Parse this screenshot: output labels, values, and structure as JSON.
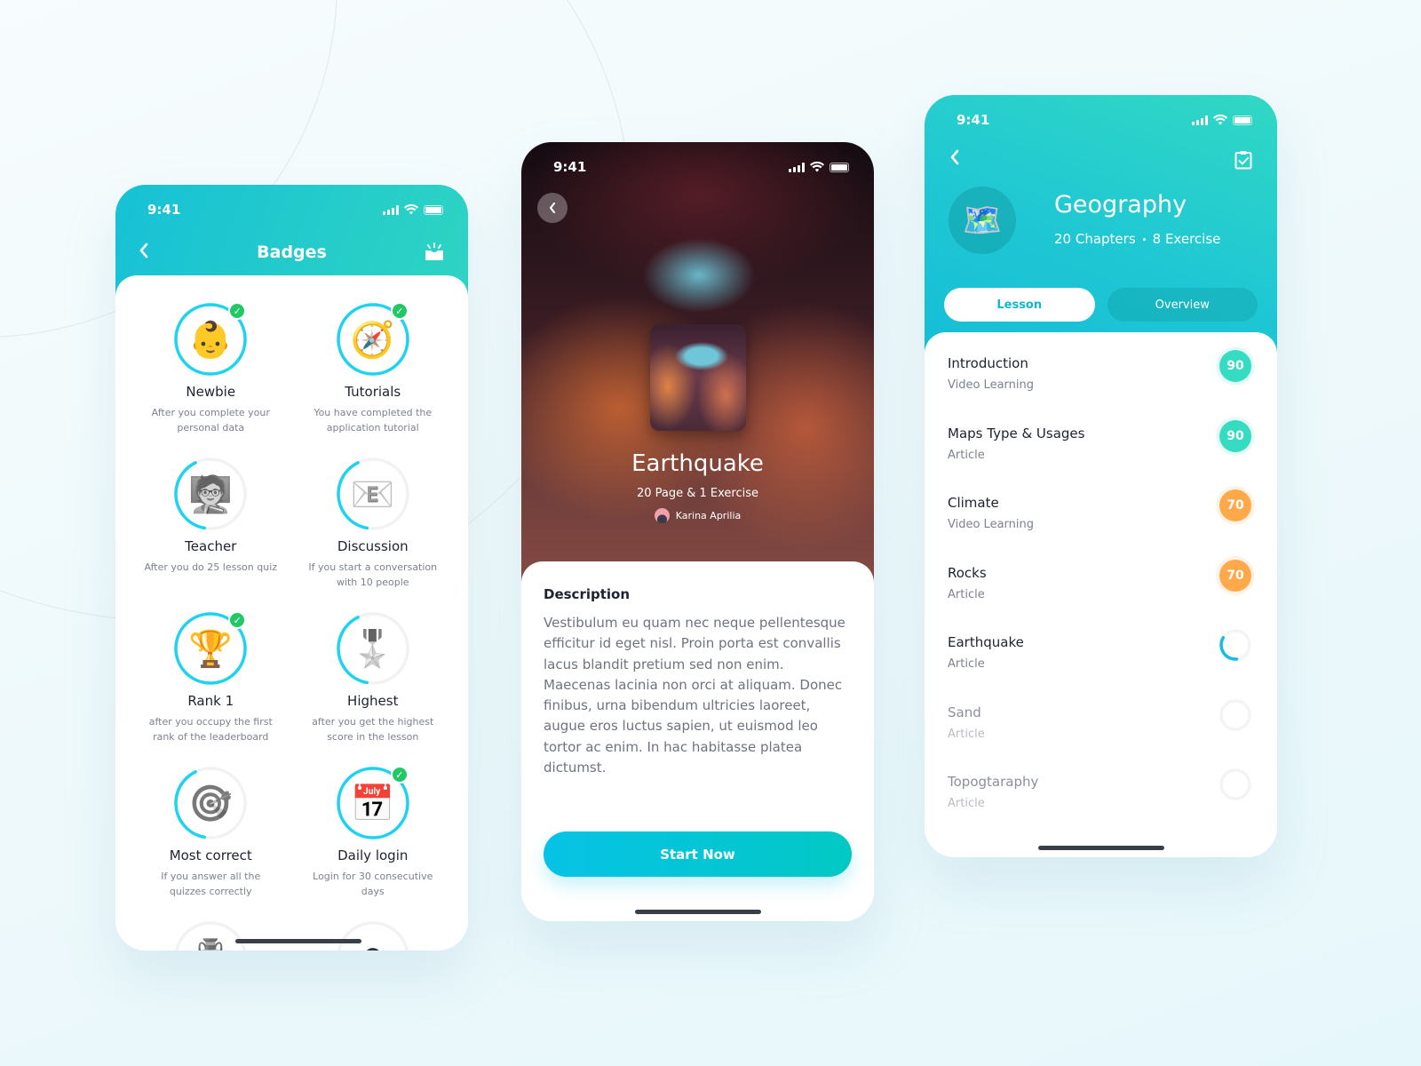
{
  "colors": {
    "accent": "#17c1d6",
    "accent_2": "#2ed4c2",
    "ring": "#1ed3ef",
    "ring_track": "#f1f2f4",
    "check_green": "#22c866",
    "score_high": "#35dcc2",
    "score_mid": "#ffa94a"
  },
  "status_bar": {
    "time": "9:41"
  },
  "badges_screen": {
    "title": "Badges",
    "back_icon": "chevron-left-icon",
    "action_icon": "share-rays-icon",
    "badges": [
      {
        "name": "Newbie",
        "desc": "After you complete your personal data",
        "icon": "baby-face-icon",
        "emoji": "👶",
        "earned": true,
        "progress": 1.0
      },
      {
        "name": "Tutorials",
        "desc": "You have completed the application tutorial",
        "icon": "compass-icon",
        "emoji": "🧭",
        "earned": true,
        "progress": 1.0
      },
      {
        "name": "Teacher",
        "desc": "After you do 25 lesson quiz",
        "icon": "teacher-icon",
        "emoji": "🧑‍🏫",
        "earned": false,
        "progress": 0.4
      },
      {
        "name": "Discussion",
        "desc": "If you start a conversation with 10 people",
        "icon": "email-at-icon",
        "emoji": "📧",
        "earned": false,
        "progress": 0.4
      },
      {
        "name": "Rank 1",
        "desc": "after you occupy the first rank of the leaderboard",
        "icon": "trophy-icon",
        "emoji": "🏆",
        "earned": true,
        "progress": 1.0
      },
      {
        "name": "Highest",
        "desc": "after you get the highest score in the lesson",
        "icon": "medal-icon",
        "emoji": "🎖️",
        "earned": false,
        "progress": 0.4
      },
      {
        "name": "Most correct",
        "desc": "If you answer all the quizzes correctly",
        "icon": "target-icon",
        "emoji": "🎯",
        "earned": false,
        "progress": 0.4
      },
      {
        "name": "Daily login",
        "desc": "Login for 30 consecutive days",
        "icon": "calendar-icon",
        "emoji": "📅",
        "earned": true,
        "progress": 1.0
      },
      {
        "name": "",
        "desc": "",
        "icon": "cup-icon",
        "emoji": "🏺",
        "earned": false,
        "progress": 0.15
      },
      {
        "name": "",
        "desc": "",
        "icon": "orb-icon",
        "emoji": "⚪",
        "earned": false,
        "progress": 0.15
      }
    ]
  },
  "lesson_screen": {
    "title": "Earthquake",
    "meta": "20 Page & 1 Exercise",
    "author": "Karina Aprilia",
    "description_title": "Description",
    "description": "Vestibulum eu quam nec neque pellentesque efficitur id eget nisl. Proin porta est convallis lacus blandit pretium sed non enim. Maecenas lacinia non orci at aliquam. Donec finibus, urna bibendum ultricies laoreet, augue eros luctus sapien, ut euismod leo tortor ac enim. In hac habitasse platea dictumst.",
    "start_button": "Start Now"
  },
  "subject_screen": {
    "title": "Geography",
    "chapters": "20 Chapters",
    "exercises": "8 Exercise",
    "subject_icon": "world-map-icon",
    "tabs": [
      {
        "label": "Lesson",
        "active": true
      },
      {
        "label": "Overview",
        "active": false
      }
    ],
    "lessons": [
      {
        "title": "Introduction",
        "type": "Video Learning",
        "score": "90",
        "status": "high"
      },
      {
        "title": "Maps Type & Usages",
        "type": "Article",
        "score": "90",
        "status": "high"
      },
      {
        "title": "Climate",
        "type": "Video Learning",
        "score": "70",
        "status": "mid"
      },
      {
        "title": "Rocks",
        "type": "Article",
        "score": "70",
        "status": "mid"
      },
      {
        "title": "Earthquake",
        "type": "Article",
        "score": null,
        "status": "in-progress",
        "progress": 0.35
      },
      {
        "title": "Sand",
        "type": "Article",
        "score": null,
        "status": "locked",
        "progress": 0
      },
      {
        "title": "Topogtaraphy",
        "type": "Article",
        "score": null,
        "status": "locked",
        "progress": 0
      }
    ]
  }
}
